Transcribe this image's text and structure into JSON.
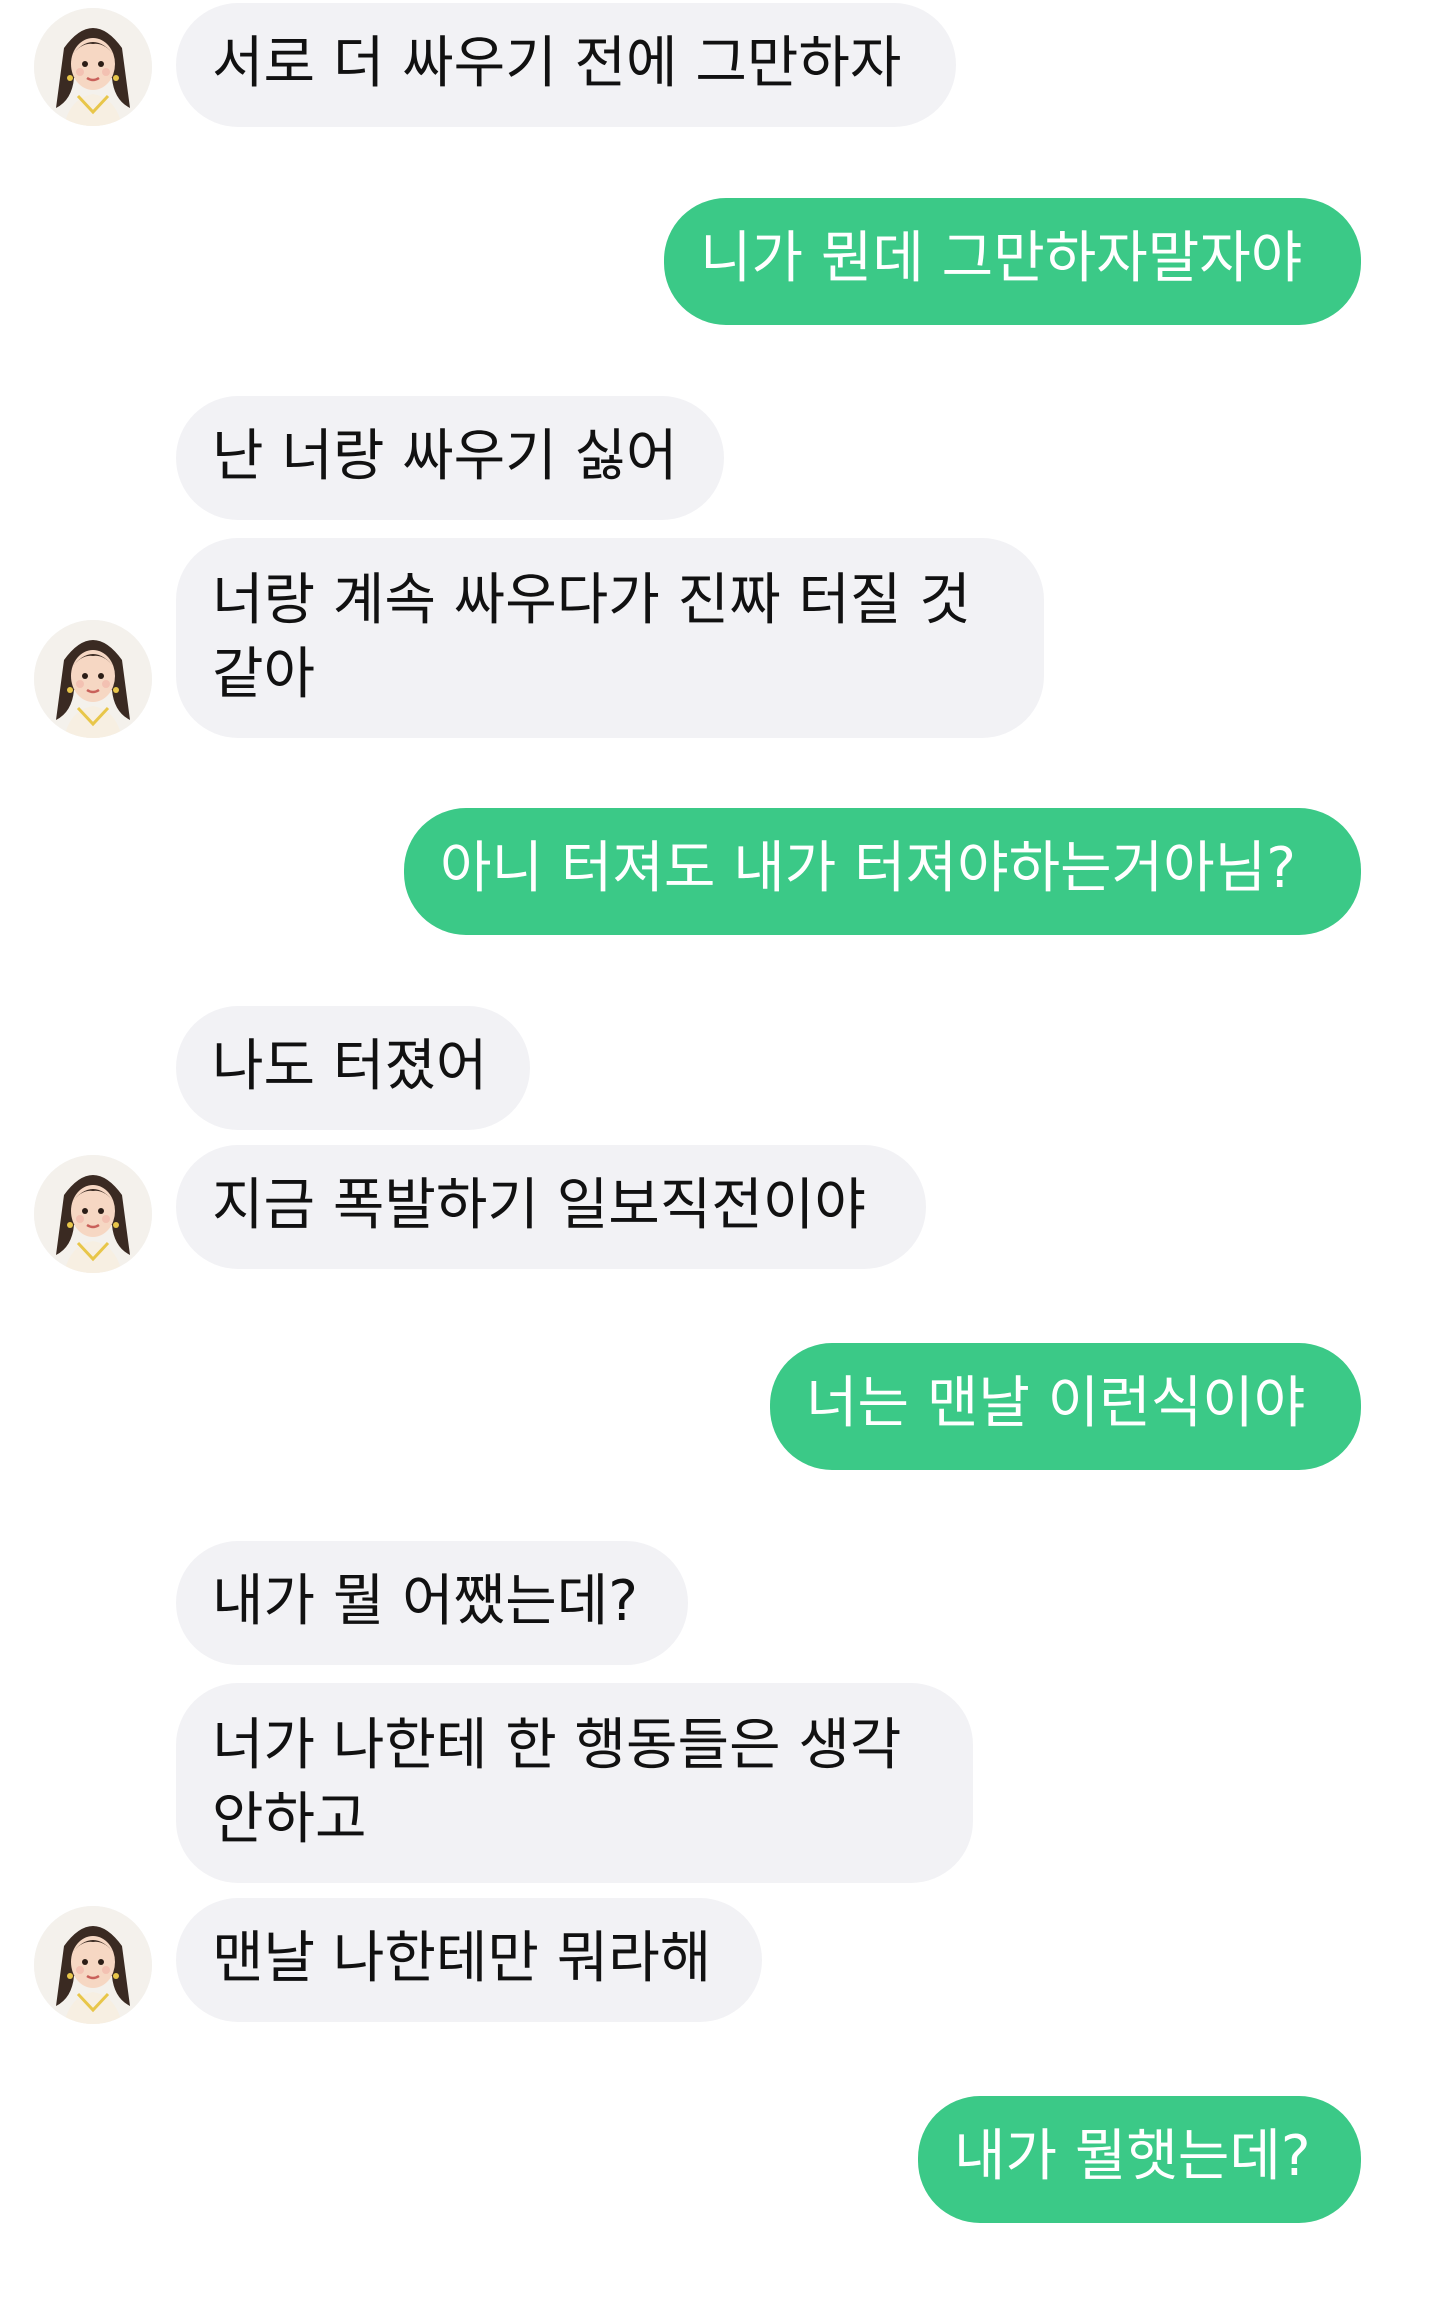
{
  "conversation": {
    "contact_avatar": "girl-portrait-avatar",
    "incoming_bubble_color": "#f2f2f5",
    "outgoing_bubble_color": "#3bc987",
    "messages": [
      {
        "side": "in",
        "text": "서로 더 싸우기 전에 그만하자"
      },
      {
        "side": "out",
        "text": "니가 뭔데 그만하자말자야"
      },
      {
        "side": "in",
        "text": "난 너랑 싸우기 싫어"
      },
      {
        "side": "in",
        "text": "너랑 계속 싸우다가 진짜 터질 것 같아"
      },
      {
        "side": "out",
        "text": "아니 터져도 내가 터져야하는거아님?"
      },
      {
        "side": "in",
        "text": "나도 터졌어"
      },
      {
        "side": "in",
        "text": "지금 폭발하기 일보직전이야"
      },
      {
        "side": "out",
        "text": "너는 맨날 이런식이야"
      },
      {
        "side": "in",
        "text": "내가 뭘 어쨌는데?"
      },
      {
        "side": "in",
        "text": "너가 나한테 한 행동들은 생각 안하고"
      },
      {
        "side": "in",
        "text": "맨날 나한테만 뭐라해"
      },
      {
        "side": "out",
        "text": "내가 뭘햇는데?"
      }
    ]
  }
}
